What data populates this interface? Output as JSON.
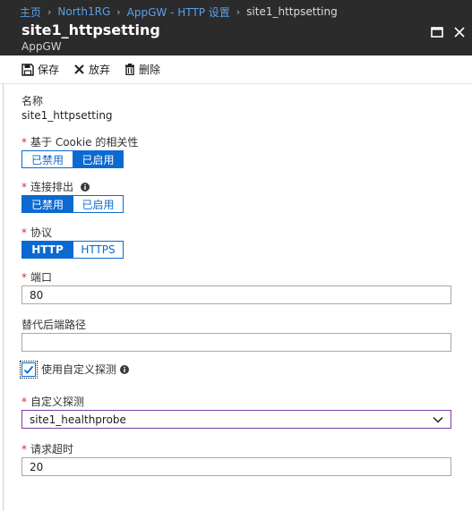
{
  "breadcrumb": {
    "items": [
      "主页",
      "North1RG",
      "AppGW - HTTP 设置",
      "site1_httpsetting"
    ],
    "separator": "›"
  },
  "header": {
    "title": "site1_httpsetting",
    "subtitle": "AppGW"
  },
  "toolbar": {
    "save_label": "保存",
    "discard_label": "放弃",
    "delete_label": "删除"
  },
  "form": {
    "name": {
      "label": "名称",
      "value": "site1_httpsetting"
    },
    "cookie_affinity": {
      "label": "基于 Cookie 的相关性",
      "options": [
        "已禁用",
        "已启用"
      ],
      "selected": "已启用"
    },
    "connection_draining": {
      "label": "连接排出",
      "options": [
        "已禁用",
        "已启用"
      ],
      "selected": "已禁用"
    },
    "protocol": {
      "label": "协议",
      "options": [
        "HTTP",
        "HTTPS"
      ],
      "selected": "HTTP"
    },
    "port": {
      "label": "端口",
      "value": "80"
    },
    "override_path": {
      "label": "替代后端路径",
      "value": ""
    },
    "use_custom_probe": {
      "label": "使用自定义探测",
      "checked": true
    },
    "custom_probe": {
      "label": "自定义探测",
      "value": "site1_healthprobe"
    },
    "request_timeout": {
      "label": "请求超时",
      "value": "20"
    }
  },
  "colors": {
    "accent": "#0b6ad1",
    "header_bg": "#2b2b2b",
    "required": "#d23030",
    "select_border": "#7a3ea8"
  },
  "icons": {
    "save": "save-icon",
    "discard": "close-icon",
    "delete": "trash-icon",
    "maximize": "maximize-icon",
    "close": "close-icon",
    "info": "info-icon",
    "dropdown": "chevron-down-icon",
    "check": "checkmark-icon"
  }
}
